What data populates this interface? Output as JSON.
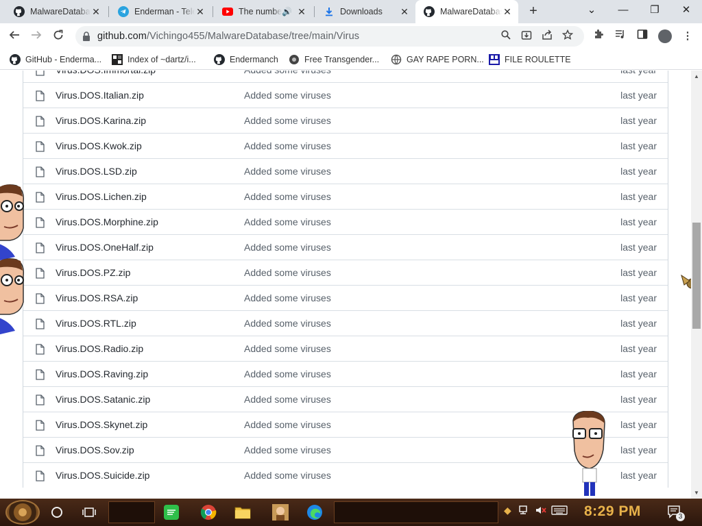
{
  "browser": {
    "tabs": [
      {
        "title": "MalwareDatabase",
        "icon": "github-icon",
        "active": false
      },
      {
        "title": "Enderman - Telegram",
        "icon": "telegram-icon",
        "active": false
      },
      {
        "title": "The number",
        "icon": "youtube-icon",
        "active": false,
        "audio": true
      },
      {
        "title": "Downloads",
        "icon": "download-icon",
        "active": false
      },
      {
        "title": "MalwareDatabase",
        "icon": "github-icon",
        "active": true
      }
    ],
    "new_tab_label": "+",
    "url_host": "github.com",
    "url_path": "/Vichingo455/MalwareDatabase/tree/main/Virus",
    "window_controls": {
      "minimize": "—",
      "maximize": "❐",
      "close": "✕",
      "tab_search": "⌄"
    }
  },
  "bookmarks": [
    {
      "label": "GitHub - Enderma...",
      "icon": "github-icon"
    },
    {
      "label": "Index of ~dartz/i...",
      "icon": "index-icon"
    },
    {
      "label": "Endermanch",
      "icon": "github-icon"
    },
    {
      "label": "Free Transgender...",
      "icon": "site-icon"
    },
    {
      "label": "GAY RAPE PORN...",
      "icon": "globe-icon"
    },
    {
      "label": "FILE ROULETTE",
      "icon": "file-roulette-icon"
    }
  ],
  "files": [
    {
      "name": "Virus.DOS.Immortal.zip",
      "message": "Added some viruses",
      "age": "last year"
    },
    {
      "name": "Virus.DOS.Italian.zip",
      "message": "Added some viruses",
      "age": "last year"
    },
    {
      "name": "Virus.DOS.Karina.zip",
      "message": "Added some viruses",
      "age": "last year"
    },
    {
      "name": "Virus.DOS.Kwok.zip",
      "message": "Added some viruses",
      "age": "last year"
    },
    {
      "name": "Virus.DOS.LSD.zip",
      "message": "Added some viruses",
      "age": "last year"
    },
    {
      "name": "Virus.DOS.Lichen.zip",
      "message": "Added some viruses",
      "age": "last year"
    },
    {
      "name": "Virus.DOS.Morphine.zip",
      "message": "Added some viruses",
      "age": "last year"
    },
    {
      "name": "Virus.DOS.OneHalf.zip",
      "message": "Added some viruses",
      "age": "last year"
    },
    {
      "name": "Virus.DOS.PZ.zip",
      "message": "Added some viruses",
      "age": "last year"
    },
    {
      "name": "Virus.DOS.RSA.zip",
      "message": "Added some viruses",
      "age": "last year"
    },
    {
      "name": "Virus.DOS.RTL.zip",
      "message": "Added some viruses",
      "age": "last year"
    },
    {
      "name": "Virus.DOS.Radio.zip",
      "message": "Added some viruses",
      "age": "last year"
    },
    {
      "name": "Virus.DOS.Raving.zip",
      "message": "Added some viruses",
      "age": "last year"
    },
    {
      "name": "Virus.DOS.Satanic.zip",
      "message": "Added some viruses",
      "age": "last year"
    },
    {
      "name": "Virus.DOS.Skynet.zip",
      "message": "Added some viruses",
      "age": "last year"
    },
    {
      "name": "Virus.DOS.Sov.zip",
      "message": "Added some viruses",
      "age": "last year"
    },
    {
      "name": "Virus.DOS.Suicide.zip",
      "message": "Added some viruses",
      "age": "last year"
    }
  ],
  "taskbar": {
    "clock": "8:29 PM",
    "notification_count": "3",
    "apps": [
      "task-view-icon",
      "spotify-icon",
      "chrome-icon",
      "file-explorer-icon",
      "app-icon",
      "edge-icon"
    ]
  },
  "colors": {
    "accent": "#e8b24a",
    "link_text": "#24292f",
    "muted_text": "#57606a"
  }
}
